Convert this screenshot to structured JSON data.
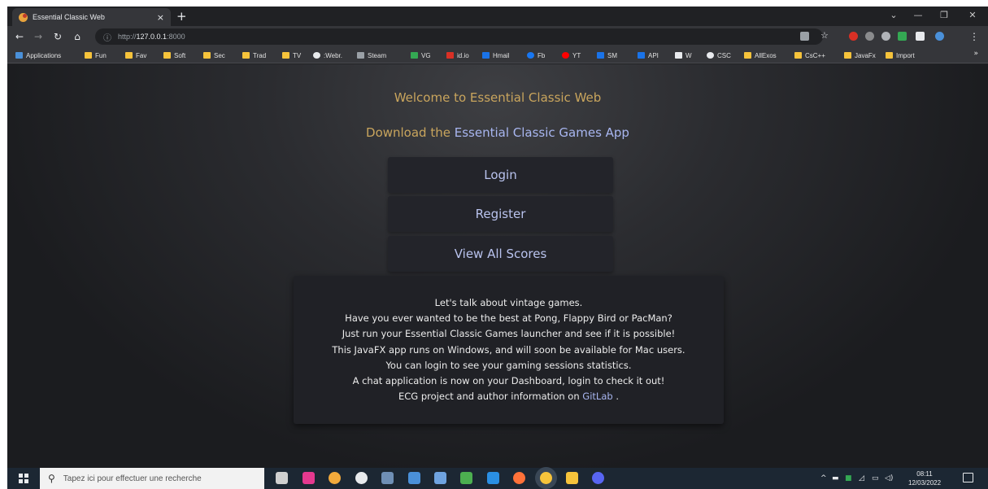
{
  "browser": {
    "tab_title": "Essential Classic Web",
    "tab_close": "×",
    "new_tab": "+",
    "url_prefix": "http://",
    "url_host": "127.0.0.1",
    "url_port": ":8000",
    "bookmarks": [
      "Applications",
      "Fun",
      "Fav",
      "Soft",
      "Sec",
      "Trad",
      "TV",
      ":Webr.",
      "Steam",
      "VG",
      "id.io",
      "Hmail",
      "Fb",
      "YT",
      "SM",
      "API",
      "W",
      "CSC",
      "AllExos",
      "CsC++",
      "JavaFx",
      "Import"
    ],
    "bookmark_more": "»"
  },
  "page": {
    "welcome": "Welcome to Essential Classic Web",
    "download_prefix": "Download the",
    "download_link": "Essential Classic Games App",
    "buttons": {
      "login": "Login",
      "register": "Register",
      "scores": "View All Scores"
    },
    "info_lines": [
      "Let's talk about vintage games.",
      "Have you ever wanted to be the best at Pong, Flappy Bird or PacMan?",
      "Just run your Essential Classic Games launcher and see if it is possible!",
      "This JavaFX app runs on Windows, and will soon be available for Mac users.",
      "You can login to see your gaming sessions statistics.",
      "A chat application is now on your Dashboard, login to check it out!"
    ],
    "info_last_prefix": "ECG project and author information on",
    "info_last_link": "GitLab",
    "info_last_suffix": "."
  },
  "taskbar": {
    "search_placeholder": "Tapez ici pour effectuer une recherche",
    "time": "08:11",
    "date": "12/03/2022"
  },
  "colors": {
    "accent_gold": "#c9a55d",
    "link_blue": "#a8b6f0"
  }
}
